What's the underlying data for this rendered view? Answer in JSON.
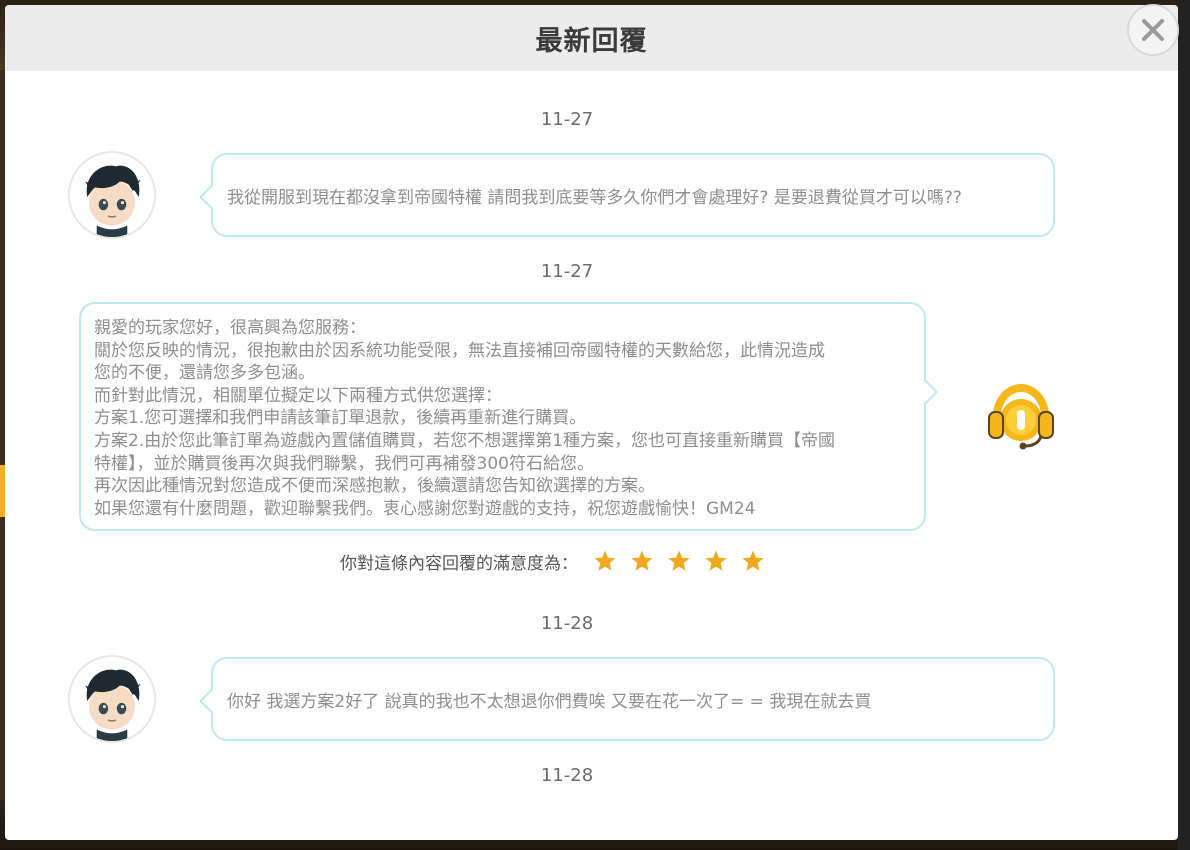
{
  "dialog": {
    "title": "最新回覆"
  },
  "messages": [
    {
      "date": "11-27",
      "sender": "player",
      "text": "我從開服到現在都沒拿到帝國特權  請問我到底要等多久你們才會處理好?  是要退費從買才可以嗎??"
    },
    {
      "date": "11-27",
      "sender": "gm",
      "lines": [
        "親愛的玩家您好，很高興為您服務：",
        "關於您反映的情況，很抱歉由於因系統功能受限，無法直接補回帝國特權的天數給您，此情況造成",
        "您的不便，還請您多多包涵。",
        "而針對此情況，相關單位擬定以下兩種方式供您選擇：",
        "方案1.您可選擇和我們申請該筆訂單退款，後續再重新進行購買。",
        "方案2.由於您此筆訂單為遊戲內置儲值購買，若您不想選擇第1種方案，您也可直接重新購買【帝國",
        "特權】，並於購買後再次與我們聯繫，我們可再補發300符石給您。",
        "再次因此種情況對您造成不便而深感抱歉，後續還請您告知欲選擇的方案。",
        "如果您還有什麼問題，歡迎聯繫我們。衷心感謝您對遊戲的支持，祝您遊戲愉快！GM24"
      ]
    },
    {
      "date": "11-28",
      "sender": "player",
      "text": "你好  我選方案2好了  說真的我也不太想退你們費唉  又要在花一次了= =  我現在就去買"
    },
    {
      "date": "11-28"
    }
  ],
  "rating": {
    "label": "你對這條內容回覆的滿意度為：",
    "stars": 5,
    "star_color": "#f2a81d"
  },
  "colors": {
    "bubble_border": "#bfe7f3",
    "header_bg": "#ececec",
    "gm_icon": "#f4b61a"
  },
  "icons": {
    "close": "close-icon",
    "player_avatar": "player-avatar",
    "gm": "headset-icon",
    "star": "star-icon"
  }
}
